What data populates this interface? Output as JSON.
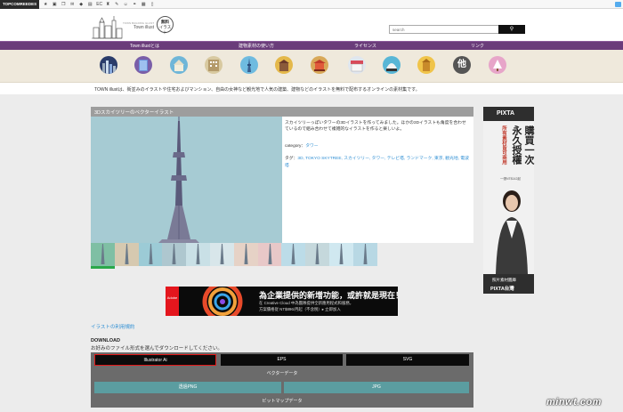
{
  "topbar": {
    "brand": "TOPCOMREEDES",
    "icons": [
      "star-icon",
      "bookmark-icon",
      "copy-icon",
      "comment-icon",
      "folder-icon",
      "feed-icon",
      "ec-icon",
      "bag-icon",
      "pencil-icon",
      "smile-icon",
      "link-icon",
      "grid-icon",
      "book-icon"
    ],
    "icon_glyphs": [
      "★",
      "▣",
      "❐",
      "✉",
      "◆",
      "▤",
      "EC",
      "♜",
      "✎",
      "☺",
      "⚭",
      "▦",
      "▯"
    ]
  },
  "header": {
    "logo_text": "Town illust",
    "logo_subtitle": "TOWN BUILDING ILLUST",
    "free_badge_line1": "無料",
    "free_badge_line2": "イラスト",
    "search_placeholder": "search"
  },
  "nav": {
    "items": [
      "Town illustとは",
      "建物素材の使い方",
      "ライセンス",
      "リンク"
    ]
  },
  "categories": [
    "city-icon",
    "building-icon",
    "house-icon",
    "mansion-icon",
    "tower-icon",
    "castle-icon",
    "temple-icon",
    "shop-icon",
    "dome-icon",
    "shrine-icon",
    "other-icon",
    "tree-icon"
  ],
  "category_labels": {
    "other": "他"
  },
  "intro": "TOWN illustは、街並みのイラストや住宅およびマンション、自由の女神など観光地で人気の建築、建物などのイラストを無料で配布するオンラインの素材集です。",
  "article": {
    "title": "3Dスカイツリーのベクターイラスト",
    "description": "スカイツリーっぽいタワーの3Dイラストを作ってみました。ほかの3Dイラストも角度を合わせているので組み合わせて複雑的なイラストを作ると楽しいよ。",
    "category_label": "category：",
    "category_value": "タワー",
    "tags_label": "タグ：",
    "tags": "3D, TOKYO SKYTREE, スカイツリー, タワー, テレビ塔, ランドマーク, 東京, 観光地, 電波塔"
  },
  "ad": {
    "brand": "Adobe",
    "headline": "為企業提供的新增功能，或許就是現在！",
    "line1": "在 Creative Cloud 中為團隊提供全新應用程式和服務，",
    "line2": "方案價格從 NT$896/月起（不含稅）▸ 立即加入"
  },
  "terms_link": "イラストの利用規約",
  "download": {
    "title": "DOWNLOAD",
    "subtitle": "お好みのファイル形式を選んでダウンロードしてください。",
    "buttons_top": [
      "Illustrator Ai",
      "EPS",
      "SVG"
    ],
    "vector_label": "ベクターデータ",
    "buttons_bottom": [
      "透過PNG",
      "JPG"
    ],
    "bitmap_label": "ビットマップデータ"
  },
  "side_ad": {
    "logo": "PIXTA",
    "col1": "購買一次",
    "col2": "永久授權",
    "col3": "所有素材皆可商用",
    "price": "一張NT$142起",
    "footer1": "照片素材圖庫",
    "footer2": "PIXTA台灣"
  },
  "watermark": "minwt.com"
}
